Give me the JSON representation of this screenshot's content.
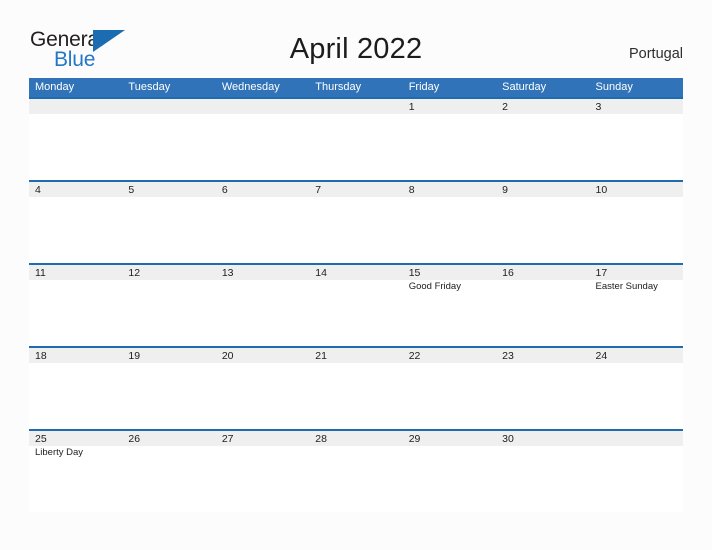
{
  "brand": {
    "name_part1": "General",
    "name_part2": "Blue",
    "flag_icon": "triangle-flag-icon"
  },
  "header": {
    "title": "April 2022",
    "region": "Portugal"
  },
  "calendar": {
    "month": "April",
    "year": "2022",
    "country": "Portugal",
    "accent_color": "#3173b8",
    "separator_color": "#1f6bb0",
    "band_color": "#efefef",
    "weekdays": [
      "Monday",
      "Tuesday",
      "Wednesday",
      "Thursday",
      "Friday",
      "Saturday",
      "Sunday"
    ],
    "weeks": [
      [
        {
          "date": "",
          "event": ""
        },
        {
          "date": "",
          "event": ""
        },
        {
          "date": "",
          "event": ""
        },
        {
          "date": "",
          "event": ""
        },
        {
          "date": "1",
          "event": ""
        },
        {
          "date": "2",
          "event": ""
        },
        {
          "date": "3",
          "event": ""
        }
      ],
      [
        {
          "date": "4",
          "event": ""
        },
        {
          "date": "5",
          "event": ""
        },
        {
          "date": "6",
          "event": ""
        },
        {
          "date": "7",
          "event": ""
        },
        {
          "date": "8",
          "event": ""
        },
        {
          "date": "9",
          "event": ""
        },
        {
          "date": "10",
          "event": ""
        }
      ],
      [
        {
          "date": "11",
          "event": ""
        },
        {
          "date": "12",
          "event": ""
        },
        {
          "date": "13",
          "event": ""
        },
        {
          "date": "14",
          "event": ""
        },
        {
          "date": "15",
          "event": "Good Friday"
        },
        {
          "date": "16",
          "event": ""
        },
        {
          "date": "17",
          "event": "Easter Sunday"
        }
      ],
      [
        {
          "date": "18",
          "event": ""
        },
        {
          "date": "19",
          "event": ""
        },
        {
          "date": "20",
          "event": ""
        },
        {
          "date": "21",
          "event": ""
        },
        {
          "date": "22",
          "event": ""
        },
        {
          "date": "23",
          "event": ""
        },
        {
          "date": "24",
          "event": ""
        }
      ],
      [
        {
          "date": "25",
          "event": "Liberty Day"
        },
        {
          "date": "26",
          "event": ""
        },
        {
          "date": "27",
          "event": ""
        },
        {
          "date": "28",
          "event": ""
        },
        {
          "date": "29",
          "event": ""
        },
        {
          "date": "30",
          "event": ""
        },
        {
          "date": "",
          "event": ""
        }
      ]
    ]
  }
}
